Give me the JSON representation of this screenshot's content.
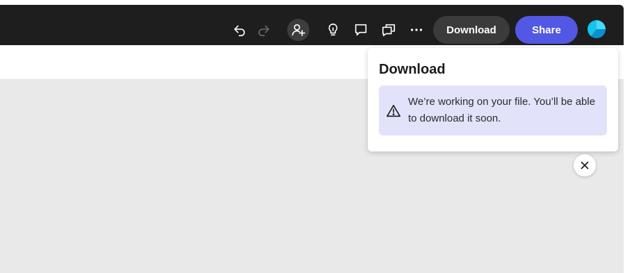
{
  "toolbar": {
    "icons": [
      "undo-icon",
      "redo-icon",
      "invite-person-icon",
      "lightbulb-icon",
      "comment-icon",
      "share-comments-icon",
      "more-icon"
    ],
    "download_label": "Download",
    "share_label": "Share",
    "share_color": "#5258e4",
    "background_color": "#1e1e1e"
  },
  "download_popover": {
    "title": "Download",
    "message": "We’re working on your file. You’ll be able to download it soon.",
    "notice_icon": "alert-triangle-icon",
    "notice_color": "#e2e3fb"
  },
  "close_icon": "close-icon"
}
